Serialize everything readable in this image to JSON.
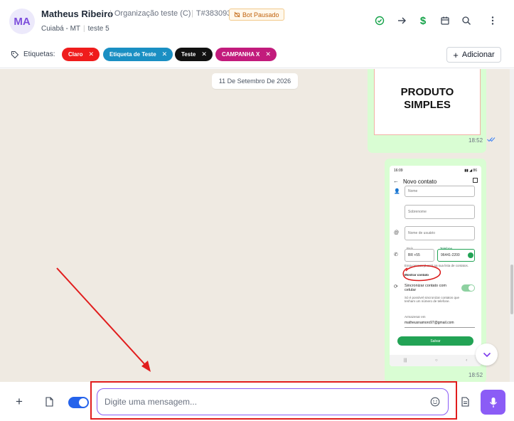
{
  "header": {
    "avatar_initials": "MA",
    "contact_name": "Matheus Ribeiro",
    "organization": "Organização teste (C)",
    "ticket": "T#383093",
    "bot_status": "Bot Pausado",
    "city": "Cuiabá - MT",
    "queue": "teste 5",
    "actions": [
      "check-circle-icon",
      "arrow-right-icon",
      "dollar-icon",
      "calendar-icon",
      "search-icon",
      "more-vertical-icon"
    ]
  },
  "tags": {
    "label": "Etiquetas:",
    "items": [
      {
        "label": "Claro",
        "color": "#ef1c1c"
      },
      {
        "label": "Etiqueta de Teste",
        "color": "#1a8fc3"
      },
      {
        "label": "Teste",
        "color": "#111111"
      },
      {
        "label": "CAMPANHA X",
        "color": "#c21b7c"
      }
    ],
    "add_label": "Adicionar"
  },
  "chat": {
    "date_separator": "11 De Setembro De 2026",
    "messages": [
      {
        "type": "image",
        "image_text_line1": "PRODUTO",
        "image_text_line2": "SIMPLES",
        "time": "18:52"
      },
      {
        "type": "image",
        "time": "18:52",
        "screenshot": {
          "status_time": "16:09",
          "status_right": "▮▮ ◢ 86",
          "title": "Novo contato",
          "field_name": "Nome",
          "field_surname": "Sobrenome",
          "field_username": "Nome de usuário",
          "country_label": "País",
          "country_value": "BR +55",
          "phone_label": "Telefone",
          "phone_value": "96441-2200",
          "hint_text": "Essa pessoa já está na sua lista de contatos.",
          "hint_link": "Mostrar contato",
          "sync_title": "Sincronizar contato com celular",
          "sync_desc": "Só é possível sincronizar contatos que tenham um número de telefone.",
          "account_label": "Armazenar em",
          "account_value": "matheusnamoro97@gmail.com",
          "save_label": "Salvar"
        }
      }
    ]
  },
  "composer": {
    "placeholder": "Digite uma mensagem...",
    "value": ""
  },
  "colors": {
    "accent": "#8b5cf6",
    "bubble_out": "#d9fdd3",
    "chat_bg": "#efeae2",
    "annotation": "#e11d1d"
  }
}
